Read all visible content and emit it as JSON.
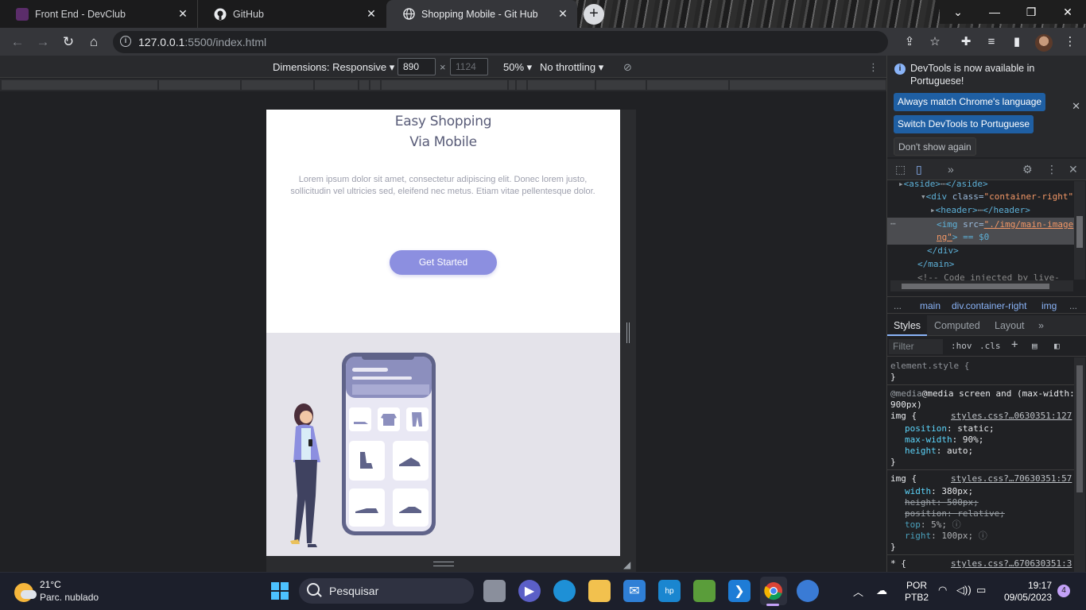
{
  "tabs": [
    {
      "title": "Front End - DevClub",
      "close": "✕"
    },
    {
      "title": "GitHub",
      "close": "✕"
    },
    {
      "title": "Shopping Mobile - Git Hub",
      "close": "✕"
    }
  ],
  "new_tab": "+",
  "window_controls": {
    "chevron": "⌄",
    "minimize": "—",
    "restore": "❐",
    "close": "✕"
  },
  "address": {
    "host": "127.0.0.1",
    "rest": ":5500/index.html"
  },
  "device_toolbar": {
    "dimensions_label": "Dimensions: Responsive",
    "width": "890",
    "times": "×",
    "height_placeholder": "1124",
    "zoom": "50%",
    "throttle": "No throttling"
  },
  "page": {
    "title_line1": "Easy Shopping",
    "title_line2": "Via Mobile",
    "lorem": "Lorem ipsum dolor sit amet, consectetur adipiscing elit. Donec lorem justo, sollicitudin vel ultricies sed, eleifend nec metus. Etiam vitae pellentesque dolor.",
    "cta": "Get Started",
    "illustration_bg": "#e4e3ea",
    "accent": "#8c8fe0"
  },
  "devtools": {
    "info_message": "DevTools is now available in Portuguese!",
    "btn_match": "Always match Chrome's language",
    "btn_switch": "Switch DevTools to Portuguese",
    "btn_dont": "Don't show again",
    "dom": {
      "l1a": "<aside>",
      "l1b": "</aside>",
      "l2tag": "<div ",
      "l2attr": "class=",
      "l2val": "\"container-right\"",
      "l3a": "<header>",
      "l3b": "</header>",
      "l4tag": "<img ",
      "l4attr": "src=",
      "l4val": "\"./img/main-image",
      "l5val": "ng\"",
      "l5rest": "> == $0",
      "l6": "</div>",
      "l7": "</main>",
      "l8": "<!-- Code injected by live-"
    },
    "crumbs": {
      "dots": "...",
      "c1": "main",
      "c2": "div.container-right",
      "c3": "img",
      "more": "..."
    },
    "subtabs": {
      "styles": "Styles",
      "computed": "Computed",
      "layout": "Layout",
      "more": "»"
    },
    "filter_placeholder": "Filter",
    "hov": ":hov",
    "cls": ".cls",
    "css": {
      "element_style": "element.style {",
      "close": "}",
      "media1": "@media screen and (max-width:",
      "media2": "900px)",
      "img_sel": "img {",
      "src1": "styles.css?…0630351:127",
      "p1": "position",
      "v1": "static;",
      "p2": "max-width",
      "v2": "90%;",
      "p3": "height",
      "v3": "auto;",
      "src2": "styles.css?…70630351:57",
      "p4": "width",
      "v4": "380px;",
      "p5": "height",
      "v5": "500px;",
      "p6": "position",
      "v6": "relative;",
      "p7": "top",
      "v7": "5%;",
      "p8": "right",
      "v8": "100px;",
      "star": "* {",
      "src3": "styles.css?…670630351:3"
    }
  },
  "taskbar": {
    "temp": "21°C",
    "weather": "Parc. nublado",
    "search": "Pesquisar",
    "lang1": "POR",
    "lang2": "PTB2",
    "time": "19:17",
    "date": "09/05/2023",
    "notifications": "4"
  }
}
